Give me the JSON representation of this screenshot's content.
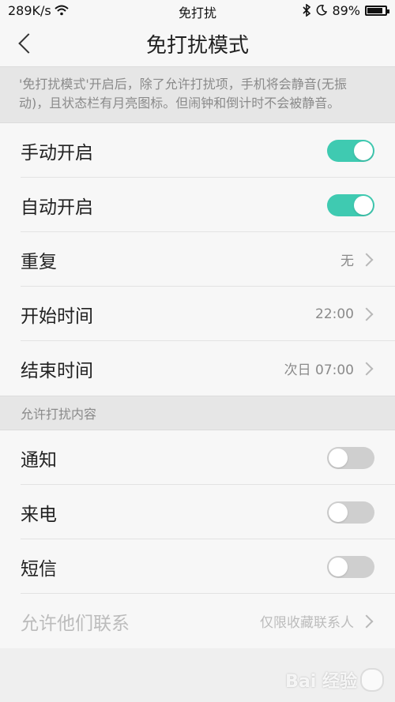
{
  "status_bar": {
    "speed": "289K/s",
    "center_title": "免打扰",
    "battery_percent": "89%",
    "battery_level": 0.89,
    "icons": [
      "wifi-icon",
      "bluetooth-icon",
      "moon-icon",
      "battery-icon"
    ]
  },
  "header": {
    "title": "免打扰模式"
  },
  "description": "'免打扰模式'开启后，除了允许打扰项，手机将会静音(无振动)，且状态栏有月亮图标。但闹钟和倒计时不会被静音。",
  "settings": {
    "manual_on": {
      "label": "手动开启",
      "enabled": true
    },
    "auto_on": {
      "label": "自动开启",
      "enabled": true
    },
    "repeat": {
      "label": "重复",
      "value": "无"
    },
    "start_time": {
      "label": "开始时间",
      "value": "22:00"
    },
    "end_time": {
      "label": "结束时间",
      "value": "次日 07:00"
    }
  },
  "allowed_section": {
    "header": "允许打扰内容",
    "notifications": {
      "label": "通知",
      "enabled": false
    },
    "calls": {
      "label": "来电",
      "enabled": false
    },
    "sms": {
      "label": "短信",
      "enabled": false
    },
    "allow_contacts": {
      "label": "允许他们联系",
      "value": "仅限收藏联系人"
    }
  },
  "watermark": "Bai 经验",
  "colors": {
    "accent": "#3fcab1",
    "toggle_off": "#cfcfcf",
    "background": "#efefef"
  }
}
